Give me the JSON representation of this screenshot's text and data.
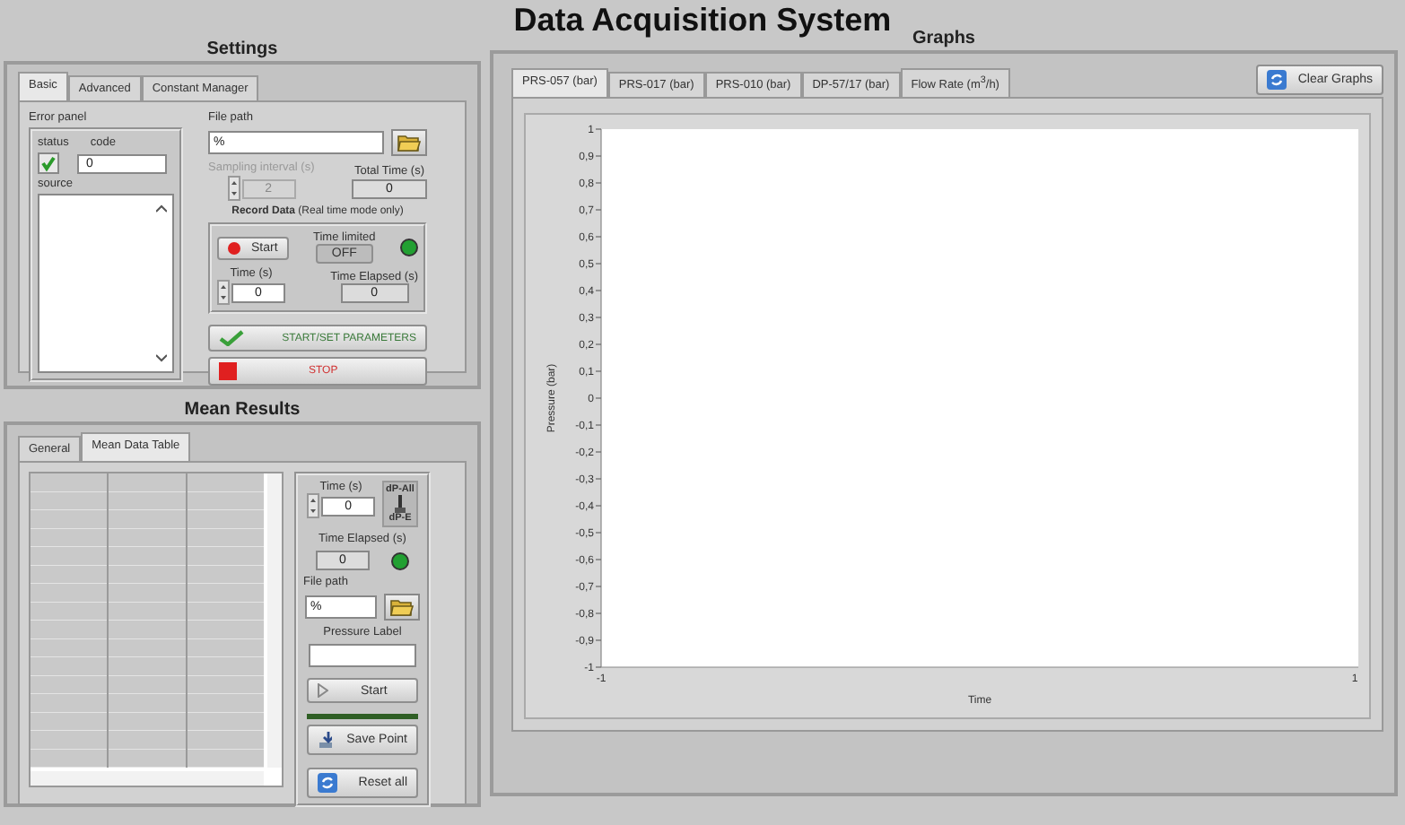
{
  "window": {
    "title": "Data Acquisition System"
  },
  "settings": {
    "title": "Settings",
    "tabs": [
      {
        "label": "Basic",
        "selected": true
      },
      {
        "label": "Advanced",
        "selected": false
      },
      {
        "label": "Constant Manager",
        "selected": false
      }
    ],
    "error_panel": {
      "label": "Error panel",
      "status_label": "status",
      "status_ok": true,
      "code_label": "code",
      "code": "0",
      "source_label": "source"
    },
    "file_path": {
      "label": "File path",
      "prefix": "%"
    },
    "sampling_interval": {
      "label": "Sampling interval (s)",
      "value": "2",
      "disabled": true
    },
    "total_time": {
      "label": "Total Time (s)",
      "value": "0"
    },
    "record": {
      "title": "**Record Data** (Real time mode only)",
      "start": "Start",
      "time_limited_label": "Time limited",
      "time_limited": "OFF",
      "led_on": true,
      "time_label": "Time (s)",
      "time": "0",
      "elapsed_label": "Time Elapsed (s)",
      "elapsed": "0"
    },
    "start_button": "START/SET PARAMETERS",
    "stop_button": "STOP"
  },
  "mean_results": {
    "title": "Mean Results",
    "tabs": [
      {
        "label": "General",
        "selected": false
      },
      {
        "label": "Mean Data Table",
        "selected": true
      }
    ],
    "time_label": "Time (s)",
    "time": "0",
    "switch_top": "dP-All",
    "switch_bottom": "dP-E",
    "switch_down": true,
    "elapsed_label": "Time Elapsed (s)",
    "elapsed": "0",
    "led_on": true,
    "file_path_label": "File path",
    "prefix": "%",
    "pressure_label": "Pressure Label",
    "start": "Start",
    "progress": {
      "level": 1
    },
    "save_point": "Save Point",
    "reset": "Reset all"
  },
  "graphs": {
    "title": "Graphs",
    "clear": "Clear Graphs",
    "tabs": [
      {
        "label": "PRS-057 (bar)",
        "selected": true
      },
      {
        "label": "PRS-017 (bar)",
        "selected": false
      },
      {
        "label": "PRS-010 (bar)",
        "selected": false
      },
      {
        "label": "DP-57/17 (bar)",
        "selected": false
      },
      {
        "label": "Flow Rate  (m$^{3}$/h)",
        "selected": false
      }
    ],
    "chart_data": {
      "type": "line",
      "xlabel": "Time",
      "ylabel": "Pressure (bar)",
      "ylim": [
        -1,
        1
      ],
      "yticks": [
        {
          "value": 1,
          "label": "1"
        },
        {
          "value": 0.9,
          "label": "0,9"
        },
        {
          "value": 0.8,
          "label": "0,8"
        },
        {
          "value": 0.7,
          "label": "0,7"
        },
        {
          "value": 0.6,
          "label": "0,6"
        },
        {
          "value": 0.5,
          "label": "0,5"
        },
        {
          "value": 0.4,
          "label": "0,4"
        },
        {
          "value": 0.3,
          "label": "0,3"
        },
        {
          "value": 0.2,
          "label": "0,2"
        },
        {
          "value": 0.1,
          "label": "0,1"
        },
        {
          "value": 0,
          "label": "0"
        },
        {
          "value": -0.1,
          "label": "-0,1"
        },
        {
          "value": -0.2,
          "label": "-0,2"
        },
        {
          "value": -0.3,
          "label": "-0,3"
        },
        {
          "value": -0.4,
          "label": "-0,4"
        },
        {
          "value": -0.5,
          "label": "-0,5"
        },
        {
          "value": -0.6,
          "label": "-0,6"
        },
        {
          "value": -0.7,
          "label": "-0,7"
        },
        {
          "value": -0.8,
          "label": "-0,8"
        },
        {
          "value": -0.9,
          "label": "-0,9"
        },
        {
          "value": -1,
          "label": "-1"
        }
      ],
      "xlim": [
        -1,
        1
      ],
      "xticks": [
        {
          "value": -1,
          "label": "-1"
        },
        {
          "value": 1,
          "label": "1"
        }
      ]
    }
  }
}
